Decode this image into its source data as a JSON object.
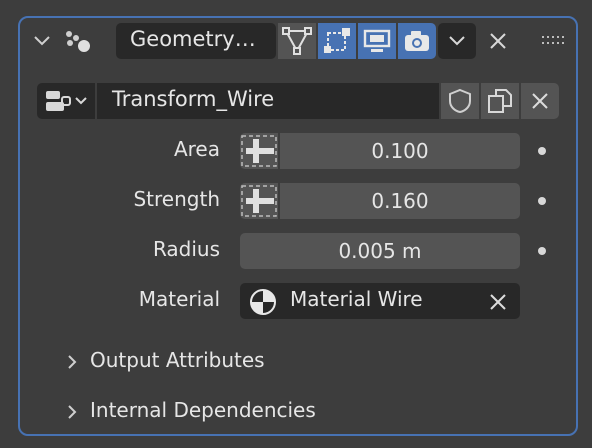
{
  "header": {
    "modifier_name": "Geometry…",
    "icons": [
      "collapse-chevron-icon",
      "geometry-nodes-icon",
      "vertex-filter-icon",
      "edit-mode-icon",
      "realtime-display-icon",
      "render-camera-icon",
      "dropdown-chevron-icon",
      "close-icon",
      "drag-handle-icon"
    ]
  },
  "node_group": {
    "name": "Transform_Wire",
    "icons": [
      "node-tree-icon",
      "fake-user-shield-icon",
      "duplicate-icon",
      "unlink-icon"
    ]
  },
  "fields": [
    {
      "label": "Area",
      "value": "0.100"
    },
    {
      "label": "Strength",
      "value": "0.160"
    },
    {
      "label": "Radius",
      "value": "0.005 m"
    }
  ],
  "material": {
    "label": "Material",
    "value": "Material Wire"
  },
  "sections": [
    {
      "label": "Output Attributes"
    },
    {
      "label": "Internal Dependencies"
    }
  ],
  "colors": {
    "accent": "#4772b3",
    "panel_bg": "#3d3d3d",
    "field_bg": "#545454",
    "dark_field": "#282828"
  }
}
